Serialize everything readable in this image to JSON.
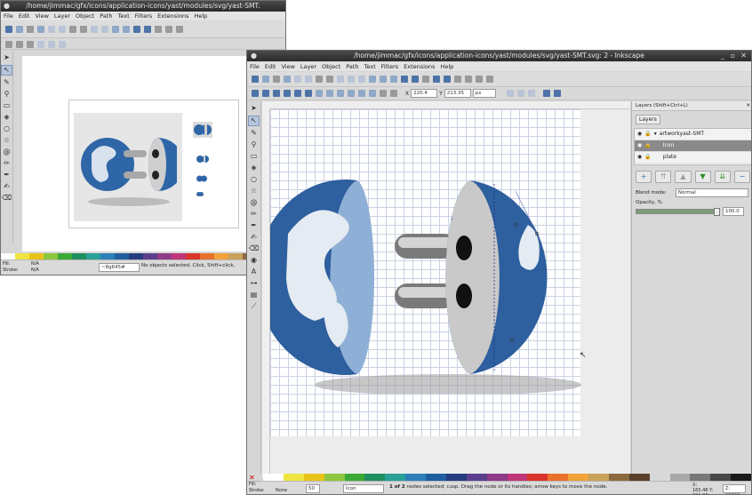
{
  "window_back": {
    "title": "/home/jimmac/gfx/icons/application-icons/yast/modules/svg/yast-SMT.",
    "menu": [
      "File",
      "Edit",
      "View",
      "Layer",
      "Object",
      "Path",
      "Text",
      "Filters",
      "Extensions",
      "Help"
    ],
    "status": {
      "fill_label": "Fill:",
      "fill_value": "N/A",
      "stroke_label": "Stroke:",
      "stroke_value": "N/A",
      "layer": "~8g645#",
      "message": "No objects selected. Click, Shift+click,"
    }
  },
  "window_front": {
    "title": "/home/jimmac/gfx/icons/application-icons/yast/modules/svg/yast-SMT.svg: 2 - Inkscape",
    "menu": [
      "File",
      "Edit",
      "View",
      "Layer",
      "Object",
      "Path",
      "Text",
      "Filters",
      "Extensions",
      "Help"
    ],
    "toolbar": {
      "x_value": "220.4",
      "y_value": "213.35",
      "unit": "px"
    },
    "status": {
      "fill_label": "Fill:",
      "stroke_label": "Stroke:",
      "stroke_value": "None",
      "opacity_value": "50",
      "layer": "Icon",
      "message_bold": "1 of 2",
      "message": " nodes selected; cusp. Drag the node or its handles; arrow keys to move the node.",
      "coords": "X: 165.46  Y: 231.38",
      "zoom": "Z: 1000%"
    }
  },
  "layers_panel": {
    "tab": "Layers (Shift+Ctrl+L)",
    "title": "Layers",
    "layers": [
      {
        "name": "artworkyast-SMT"
      },
      {
        "name": "Icon"
      },
      {
        "name": "plate"
      }
    ],
    "blend_label": "Blend mode:",
    "blend_value": "Normal",
    "opacity_label": "Opacity, %",
    "opacity_value": "100.0"
  },
  "palette_colors": [
    "#ffffff",
    "#f0e442",
    "#e8c419",
    "#8dc63f",
    "#3aa935",
    "#1e8f5e",
    "#2aa198",
    "#2d7fb8",
    "#1f5fa0",
    "#243d7e",
    "#5b3f8d",
    "#8e3b88",
    "#c0357a",
    "#d9342b",
    "#e8722d",
    "#f2a13b",
    "#c8a15a",
    "#8c6a3f",
    "#5a3f2b",
    "#d8d8d8",
    "#a8a8a8",
    "#787878",
    "#484848",
    "#1a1a1a"
  ],
  "accent_color": "#3a6ea8"
}
